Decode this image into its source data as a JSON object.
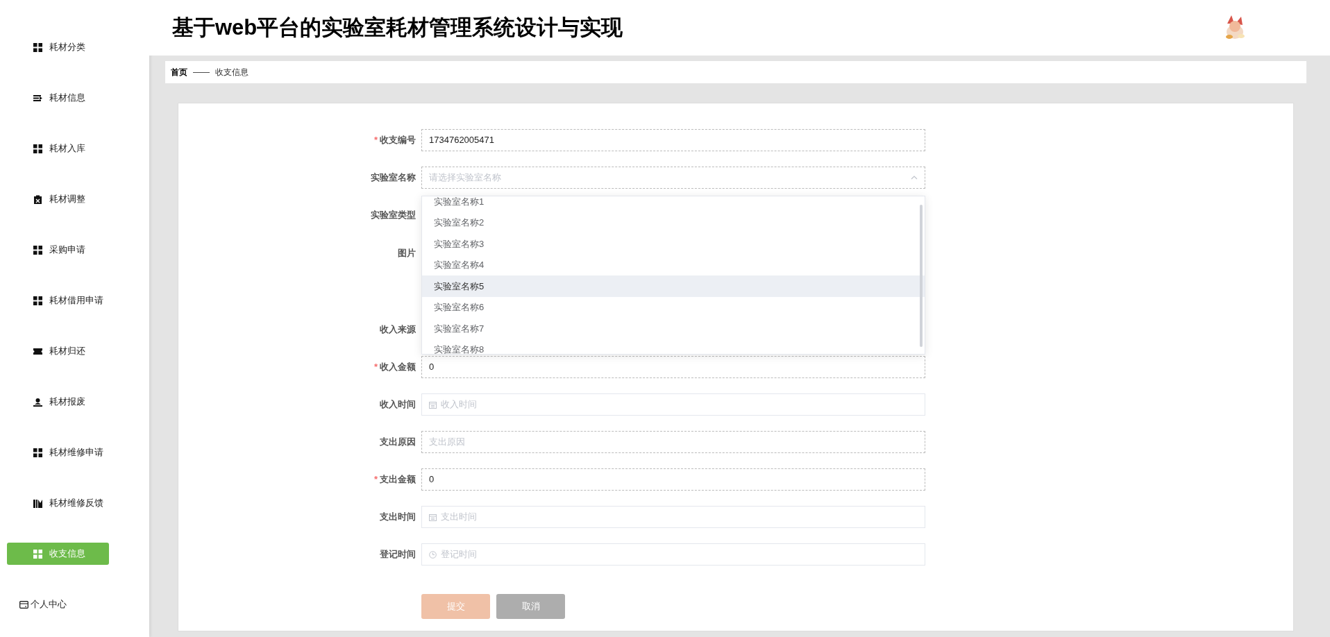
{
  "sidebar": {
    "items": [
      {
        "label": "耗材分类",
        "kind": "grid",
        "selected": false
      },
      {
        "label": "耗材信息",
        "kind": "list",
        "selected": false
      },
      {
        "label": "耗材入库",
        "kind": "grid",
        "selected": false
      },
      {
        "label": "耗材调整",
        "kind": "clipboard",
        "selected": false
      },
      {
        "label": "采购申请",
        "kind": "grid",
        "selected": false
      },
      {
        "label": "耗材借用申请",
        "kind": "grid",
        "selected": false
      },
      {
        "label": "耗材归还",
        "kind": "ticket",
        "selected": false
      },
      {
        "label": "耗材报废",
        "kind": "person",
        "selected": false
      },
      {
        "label": "耗材维修申请",
        "kind": "grid",
        "selected": false
      },
      {
        "label": "耗材维修反馈",
        "kind": "chart",
        "selected": false
      },
      {
        "label": "收支信息",
        "kind": "grid",
        "selected": true
      },
      {
        "label": "个人中心",
        "kind": "card",
        "selected": false
      }
    ]
  },
  "header": {
    "title": "基于web平台的实验室耗材管理系统设计与实现"
  },
  "breadcrumb": {
    "home": "首页",
    "separator": "——",
    "current": "收支信息"
  },
  "form": {
    "fields": [
      {
        "label": "收支编号",
        "required_mark": "*",
        "kind": "text",
        "value": "1734762005471"
      },
      {
        "label": "实验室名称",
        "kind": "select",
        "placeholder": "请选择实验室名称",
        "expanded": true
      },
      {
        "label": "实验室类型",
        "kind": "covered"
      },
      {
        "label": "图片"
      },
      {
        "label": "收入来源",
        "kind": "covered"
      },
      {
        "label": "收入金额",
        "required_mark": "*",
        "kind": "text",
        "value": "0"
      },
      {
        "label": "收入时间",
        "kind": "date",
        "placeholder": "收入时间"
      },
      {
        "label": "支出原因",
        "kind": "text",
        "placeholder": "支出原因"
      },
      {
        "label": "支出金额",
        "required_mark": "*",
        "kind": "text",
        "value": "0"
      },
      {
        "label": "支出时间",
        "kind": "date",
        "placeholder": "支出时间"
      },
      {
        "label": "登记时间",
        "kind": "time",
        "placeholder": "登记时间"
      }
    ],
    "dropdown": [
      {
        "label": "实验室名称1",
        "highlighted": false
      },
      {
        "label": "实验室名称2",
        "highlighted": false
      },
      {
        "label": "实验室名称3",
        "highlighted": false
      },
      {
        "label": "实验室名称4",
        "highlighted": false
      },
      {
        "label": "实验室名称5",
        "highlighted": true
      },
      {
        "label": "实验室名称6",
        "highlighted": false
      },
      {
        "label": "实验室名称7",
        "highlighted": false
      },
      {
        "label": "实验室名称8",
        "highlighted": false
      }
    ],
    "buttons": [
      {
        "label": "提交",
        "kind": "submit"
      },
      {
        "label": "取消",
        "kind": "cancel"
      }
    ]
  }
}
